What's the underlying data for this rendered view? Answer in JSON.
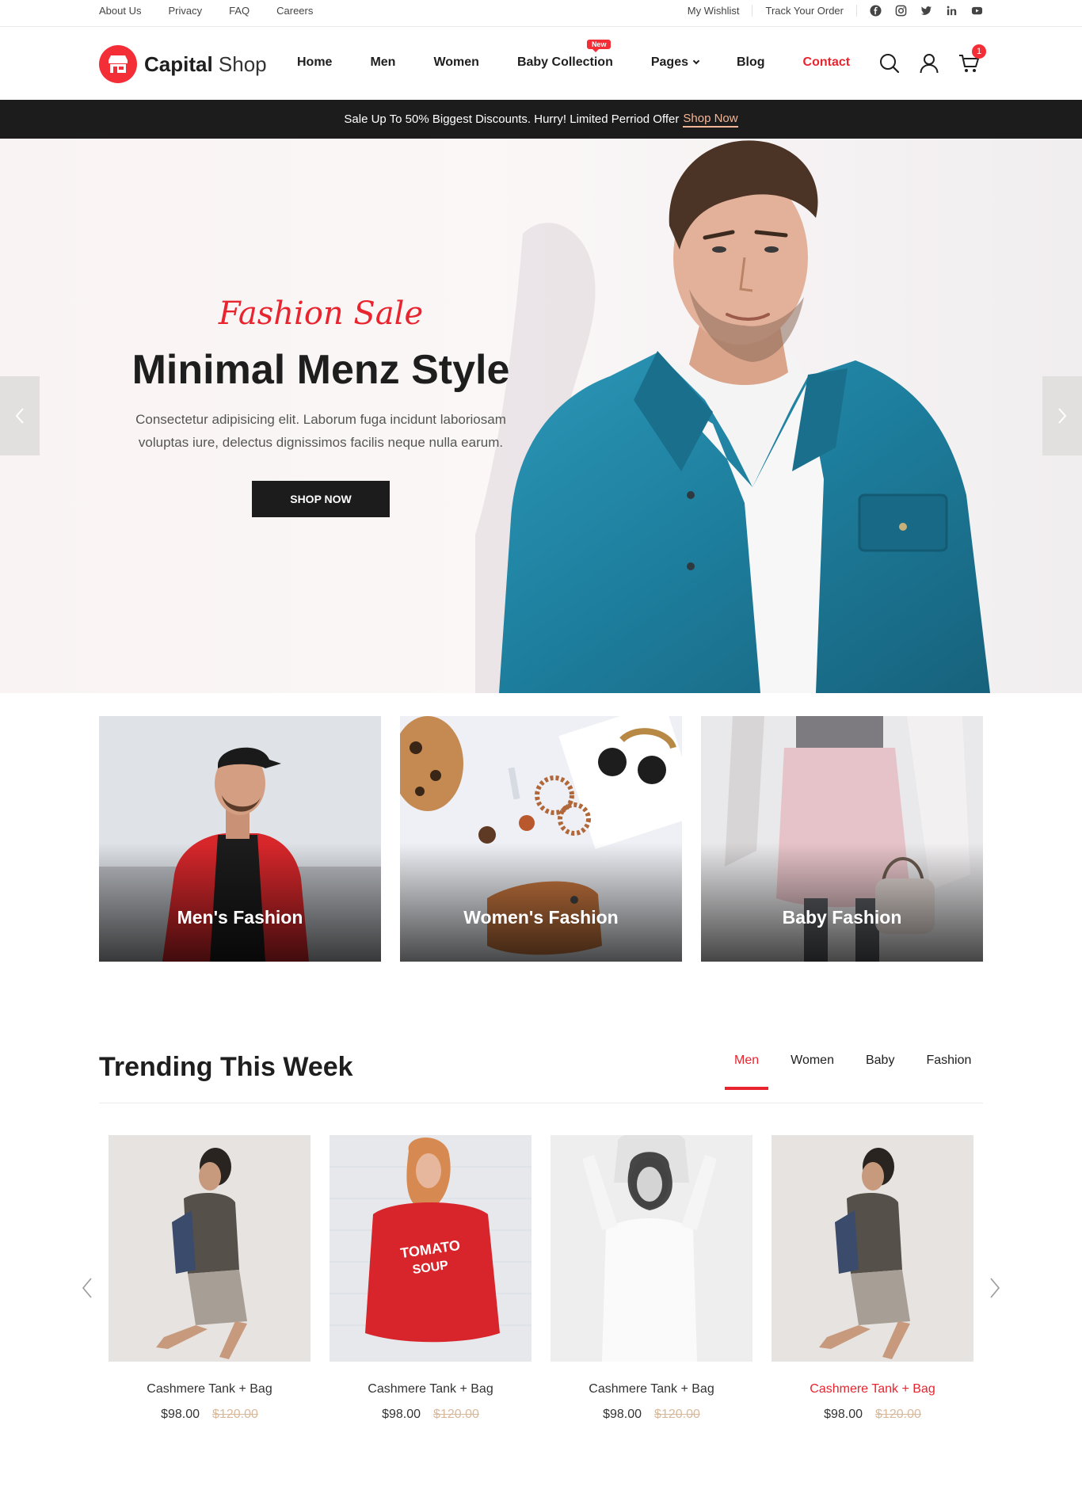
{
  "topbar": {
    "links": [
      "About Us",
      "Privacy",
      "FAQ",
      "Careers"
    ],
    "right_links": [
      "My Wishlist",
      "Track Your Order"
    ],
    "social_icons": [
      "facebook-icon",
      "instagram-icon",
      "twitter-icon",
      "linkedin-icon",
      "youtube-icon"
    ]
  },
  "header": {
    "logo_bold": "Capital",
    "logo_light": "Shop",
    "nav": [
      "Home",
      "Men",
      "Women",
      "Baby Collection",
      "Pages",
      "Blog",
      "Contact"
    ],
    "new_badge": "New",
    "cart_count": "1",
    "icons": [
      "search-icon",
      "user-icon",
      "cart-icon"
    ]
  },
  "promo": {
    "text": "Sale Up To 50% Biggest Discounts. Hurry! Limited Perriod Offer",
    "link": "Shop Now"
  },
  "hero": {
    "subtitle": "Fashion Sale",
    "title": "Minimal Menz Style",
    "description": "Consectetur adipisicing elit. Laborum fuga incidunt laboriosam voluptas iure, delectus dignissimos facilis neque nulla earum.",
    "button": "SHOP NOW"
  },
  "categories": [
    "Men's Fashion",
    "Women's Fashion",
    "Baby Fashion"
  ],
  "trending": {
    "title": "Trending This Week",
    "tabs": [
      "Men",
      "Women",
      "Baby",
      "Fashion"
    ],
    "active_tab": "Men",
    "products": [
      {
        "name": "Cashmere Tank + Bag",
        "price": "$98.00",
        "old_price": "$120.00"
      },
      {
        "name": "Cashmere Tank + Bag",
        "price": "$98.00",
        "old_price": "$120.00"
      },
      {
        "name": "Cashmere Tank + Bag",
        "price": "$98.00",
        "old_price": "$120.00"
      },
      {
        "name": "Cashmere Tank + Bag",
        "price": "$98.00",
        "old_price": "$120.00"
      }
    ]
  },
  "colors": {
    "accent": "#e8242e",
    "dark": "#1c1c1c",
    "promo_link": "#f3b596",
    "old_price": "#d9b99c"
  }
}
